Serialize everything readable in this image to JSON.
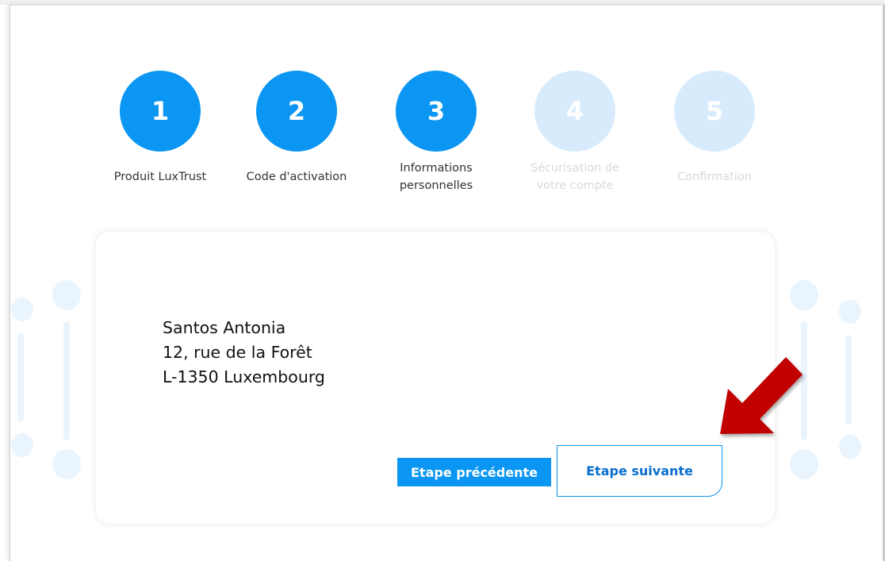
{
  "stepper": {
    "steps": [
      {
        "number": "1",
        "label_lines": [
          "Produit LuxTrust"
        ],
        "state": "completed"
      },
      {
        "number": "2",
        "label_lines": [
          "Code d'activation"
        ],
        "state": "completed"
      },
      {
        "number": "3",
        "label_lines": [
          "Informations",
          "personnelles"
        ],
        "state": "current"
      },
      {
        "number": "4",
        "label_lines": [
          "Sécurisation de",
          "votre compte"
        ],
        "state": "upcoming"
      },
      {
        "number": "5",
        "label_lines": [
          "Confirmation"
        ],
        "state": "upcoming"
      }
    ]
  },
  "address": {
    "name": "Santos Antonia",
    "street": "12, rue de la Forêt",
    "city": "L-1350 Luxembourg"
  },
  "buttons": {
    "previous": "Etape précédente",
    "next": "Etape suivante"
  },
  "colors": {
    "step_active": "#0a96f2",
    "step_inactive": "#d7ebfd",
    "decoration": "#eaf4fd",
    "annotation_arrow": "#c10000"
  },
  "icons": {
    "annotation": "red-arrow-icon"
  }
}
